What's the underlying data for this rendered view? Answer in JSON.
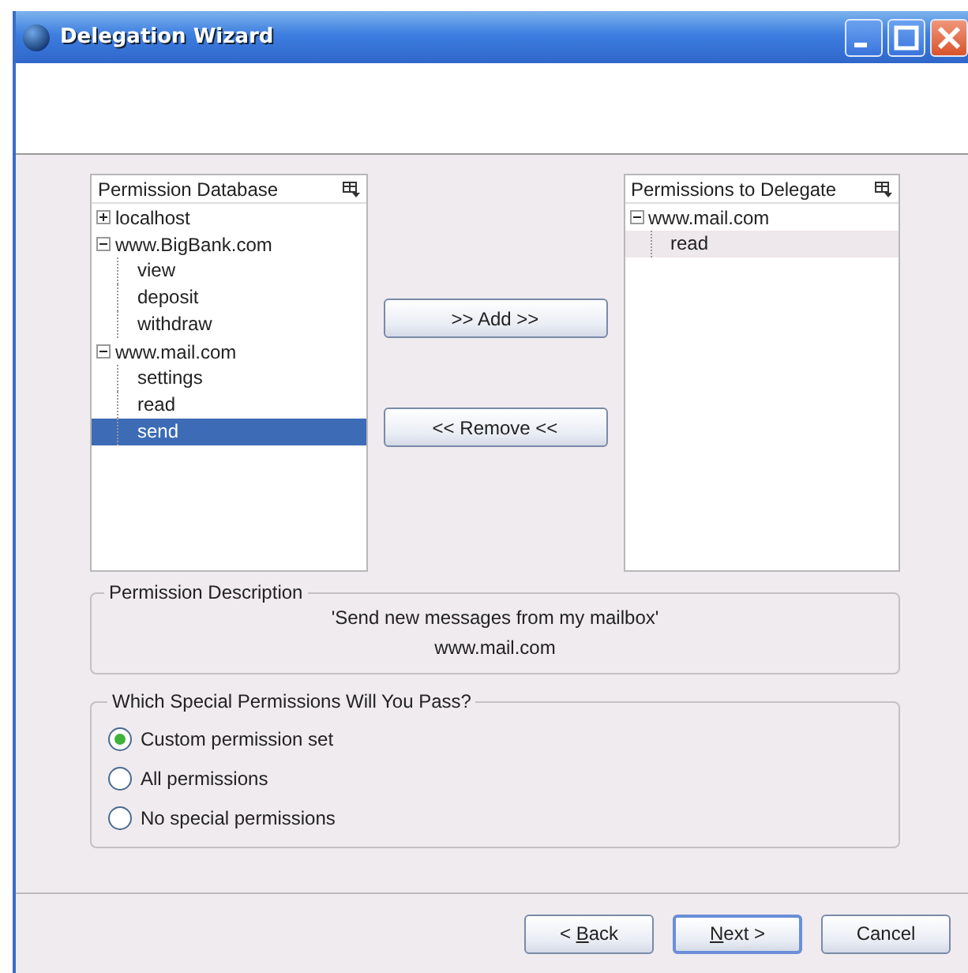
{
  "window": {
    "title": "Delegation Wizard"
  },
  "permission_database": {
    "title": "Permission Database",
    "nodes": [
      {
        "label": "localhost",
        "expanded": false,
        "selected": false
      },
      {
        "label": "www.BigBank.com",
        "expanded": true,
        "selected": false,
        "children": [
          {
            "label": "view",
            "selected": false
          },
          {
            "label": "deposit",
            "selected": false
          },
          {
            "label": "withdraw",
            "selected": false
          }
        ]
      },
      {
        "label": "www.mail.com",
        "expanded": true,
        "selected": false,
        "children": [
          {
            "label": "settings",
            "selected": false
          },
          {
            "label": "read",
            "selected": false
          },
          {
            "label": "send",
            "selected": true
          }
        ]
      }
    ]
  },
  "transfer_buttons": [
    ">> Add >>",
    "<< Remove <<"
  ],
  "permissions_to_delegate": {
    "title": "Permissions to Delegate",
    "nodes": [
      {
        "label": "www.mail.com",
        "expanded": true,
        "selected": false,
        "children": [
          {
            "label": "read",
            "selected": true
          }
        ]
      }
    ]
  },
  "permission_description": {
    "title": "Permission Description",
    "text": "'Send new messages from my mailbox'",
    "site": "www.mail.com"
  },
  "special_permissions": {
    "title": "Which Special Permissions Will You Pass?",
    "options": [
      {
        "label": "Custom permission set",
        "selected": true
      },
      {
        "label": "All permissions",
        "selected": false
      },
      {
        "label": "No special permissions",
        "selected": false
      }
    ]
  },
  "footer_buttons": [
    {
      "before": "< ",
      "mnemonic": "B",
      "after": "ack",
      "default": false
    },
    {
      "mnemonic": "N",
      "after": "ext >",
      "default": true
    },
    {
      "before": "Cancel",
      "default": false
    }
  ]
}
